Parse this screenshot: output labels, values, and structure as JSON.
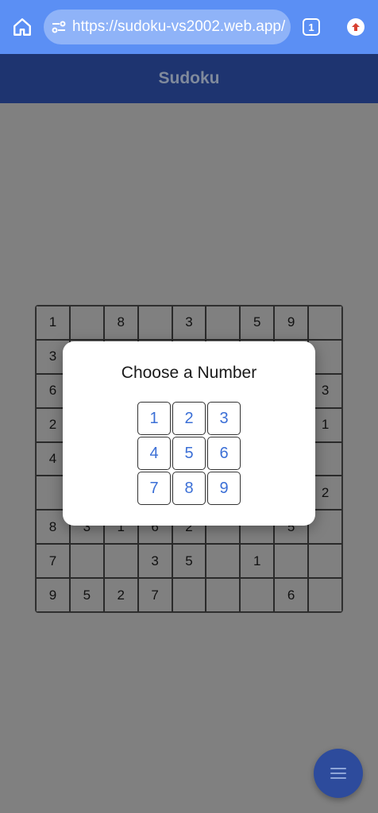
{
  "browser": {
    "url": "https://sudoku-vs2002.web.app/",
    "tab_count": "1",
    "icons": [
      "home-icon",
      "site-info-icon",
      "tab-switcher-icon",
      "extension-icon"
    ]
  },
  "app": {
    "title": "Sudoku"
  },
  "board": {
    "rows": [
      [
        "1",
        "",
        "8",
        "",
        "3",
        "",
        "5",
        "9",
        ""
      ],
      [
        "3",
        "",
        "",
        "",
        "",
        "",
        "",
        "",
        ""
      ],
      [
        "6",
        "",
        "",
        "",
        "",
        "",
        "",
        "",
        "3"
      ],
      [
        "2",
        "",
        "",
        "",
        "",
        "",
        "",
        "",
        "1"
      ],
      [
        "4",
        "",
        "",
        "",
        "",
        "",
        "",
        "",
        ""
      ],
      [
        "",
        "",
        "",
        "",
        "",
        "",
        "",
        "",
        "2"
      ],
      [
        "8",
        "3",
        "1",
        "6",
        "2",
        "",
        "",
        "5",
        ""
      ],
      [
        "7",
        "",
        "",
        "3",
        "5",
        "",
        "1",
        "",
        ""
      ],
      [
        "9",
        "5",
        "2",
        "7",
        "",
        "",
        "",
        "6",
        ""
      ]
    ]
  },
  "modal": {
    "title": "Choose a Number",
    "numbers": [
      "1",
      "2",
      "3",
      "4",
      "5",
      "6",
      "7",
      "8",
      "9"
    ]
  },
  "fab": {
    "icon": "menu-icon"
  },
  "colors": {
    "browser_bar": "#5b8ff4",
    "app_bar": "#1e3470",
    "overlay": "#808080",
    "number_text": "#3b6fd6",
    "fab": "#2d4b9c"
  }
}
